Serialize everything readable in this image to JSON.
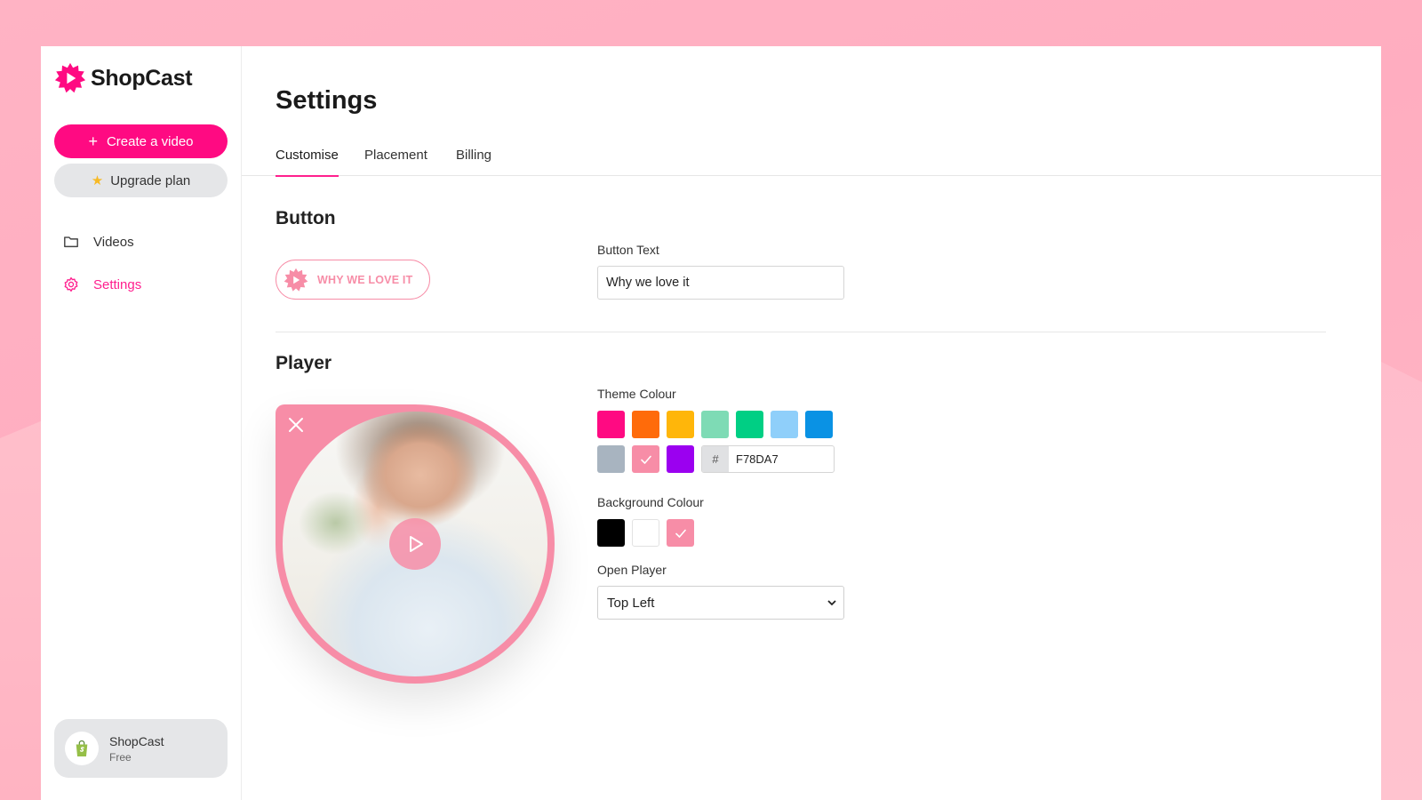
{
  "brand": {
    "name": "ShopCast",
    "accent": "#ff0a82",
    "theme_pink": "#F78DA7"
  },
  "sidebar": {
    "create_label": "Create a video",
    "create_icon": "plus-icon",
    "upgrade_label": "Upgrade plan",
    "upgrade_icon": "star-icon",
    "items": [
      {
        "label": "Videos",
        "icon": "folder-icon",
        "active": false
      },
      {
        "label": "Settings",
        "icon": "gear-icon",
        "active": true
      }
    ],
    "account": {
      "name": "ShopCast",
      "plan": "Free",
      "icon": "shopify-bag-icon"
    }
  },
  "page": {
    "title": "Settings",
    "tabs": [
      {
        "label": "Customise",
        "active": true
      },
      {
        "label": "Placement",
        "active": false
      },
      {
        "label": "Billing",
        "active": false
      }
    ]
  },
  "button_section": {
    "title": "Button",
    "preview_label": "WHY WE LOVE IT",
    "text_label": "Button Text",
    "text_value": "Why we love it"
  },
  "player_section": {
    "title": "Player",
    "theme_colour_label": "Theme Colour",
    "theme_colours": [
      "#FF0A82",
      "#FF6B0A",
      "#FFB60A",
      "#7EDBB5",
      "#00CF84",
      "#8FCFFA",
      "#0A92E4",
      "#A8B4C0",
      "#F78DA7",
      "#9B00F0"
    ],
    "theme_selected": "#F78DA7",
    "hex_prefix": "#",
    "hex_value": "F78DA7",
    "background_colour_label": "Background Colour",
    "background_colours": [
      "#000000",
      "#FFFFFF",
      "#F78DA7"
    ],
    "background_selected": "#F78DA7",
    "open_player_label": "Open Player",
    "open_player_value": "Top Left"
  }
}
